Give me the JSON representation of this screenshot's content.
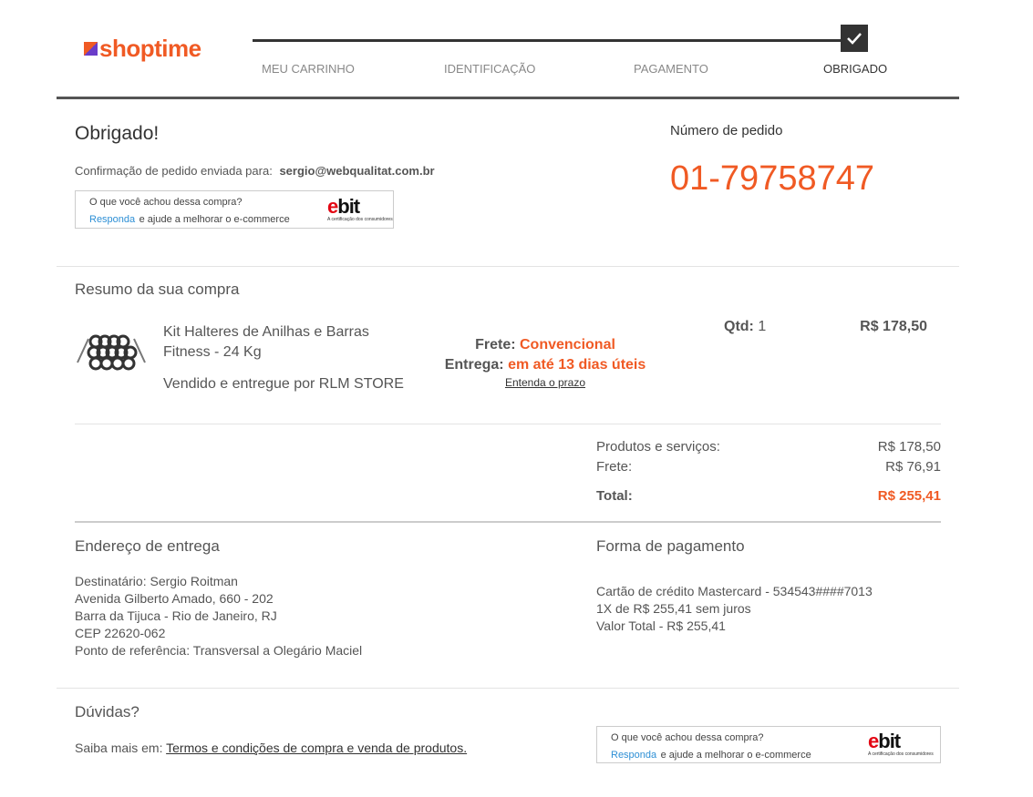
{
  "header": {
    "logo_text": "shoptime",
    "steps": [
      "MEU CARRINHO",
      "IDENTIFICAÇÃO",
      "PAGAMENTO",
      "OBRIGADO"
    ]
  },
  "confirmation": {
    "title": "Obrigado!",
    "sent_to_label": "Confirmação de pedido enviada para:",
    "email": "sergio@webqualitat.com.br",
    "order_label": "Número de pedido",
    "order_number": "01-79758747"
  },
  "ebit": {
    "question": "O que você achou dessa compra?",
    "link": "Responda",
    "rest": "e ajude a melhorar o e-commerce",
    "logo_word": "bit",
    "logo_e": "e",
    "tagline": "A certificação dos consumidores"
  },
  "summary": {
    "title": "Resumo da sua compra",
    "product_name_line1": "Kit Halteres de Anilhas e Barras",
    "product_name_line2": "Fitness - 24 Kg",
    "seller": "Vendido e entregue por RLM STORE",
    "frete_label": "Frete:",
    "frete_value": "Convencional",
    "entrega_label": "Entrega:",
    "entrega_value": "em até 13 dias úteis",
    "prazo_link": "Entenda o prazo",
    "qtd_label": "Qtd:",
    "qtd_value": "1",
    "price": "R$ 178,50"
  },
  "totals": {
    "products_label": "Produtos e serviços:",
    "products_value": "R$ 178,50",
    "frete_label": "Frete:",
    "frete_value": "R$ 76,91",
    "total_label": "Total:",
    "total_value": "R$ 255,41"
  },
  "delivery": {
    "title": "Endereço de entrega",
    "lines": [
      "Destinatário: Sergio Roitman",
      "Avenida Gilberto Amado, 660 - 202",
      "Barra da Tijuca - Rio de Janeiro, RJ",
      "CEP 22620-062",
      "Ponto de referência: Transversal a Olegário Maciel"
    ]
  },
  "payment": {
    "title": "Forma de pagamento",
    "lines": [
      "Cartão de crédito Mastercard - 534543####7013",
      "1X de R$ 255,41 sem juros",
      "Valor Total - R$ 255,41"
    ]
  },
  "help": {
    "title": "Dúvidas?",
    "prefix": "Saiba mais em:",
    "link": "Termos e condições de compra e venda de produtos."
  },
  "colors": {
    "brand_orange": "#f05a24",
    "ebit_red": "#e30613",
    "link_blue": "#2d8fd5"
  }
}
